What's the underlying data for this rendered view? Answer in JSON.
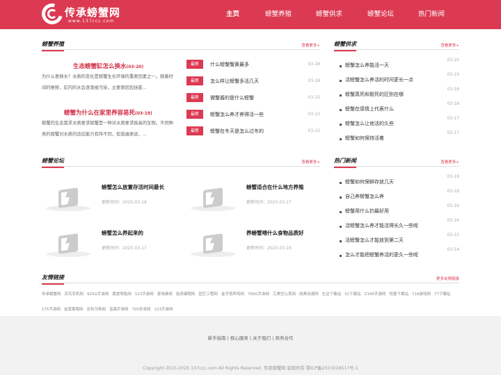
{
  "site": {
    "title": "传承螃蟹网",
    "domain": "www.137ccc.com"
  },
  "nav": [
    "主页",
    "螃蟹养殖",
    "螃蟹供求",
    "螃蟹论坛",
    "热门新闻"
  ],
  "yangzhi": {
    "title": "螃蟹养殖",
    "more": "查看更多+",
    "articles": [
      {
        "title": "生态螃蟹缸怎么换水",
        "date": "(03-20)",
        "desc": "为什么要换水？水质的变化是螃蟹生长环境的重要因素之一。随着时间的推移，缸内的水会逐渐被污染，主要原因包括废..."
      },
      {
        "title": "螃蟹为什么在家里养容易死",
        "date": "(03-19)",
        "desc": "螃蟹的生态需求水质要求螃蟹是一种对水质要求极高的生物。不同种类的螃蟹对水质的适应能力有所不同，但普遍来说，..."
      }
    ],
    "news": [
      {
        "badge": "最新",
        "text": "什么螃蟹蟹黄最多",
        "date": "03-18"
      },
      {
        "badge": "最新",
        "text": "怎么样让螃蟹多活几天",
        "date": "03-18"
      },
      {
        "badge": "最新",
        "text": "微蟹酱的是什么螃蟹",
        "date": "03-15"
      },
      {
        "badge": "最新",
        "text": "螃蟹怎么养才养得活一些",
        "date": "03-13"
      },
      {
        "badge": "最新",
        "text": "螃蟹在冬天是怎么过冬的",
        "date": "03-12"
      }
    ]
  },
  "gongqiu": {
    "title": "螃蟹供求",
    "more": "查看更多+",
    "items": [
      {
        "text": "螃蟹怎么养能活一天",
        "date": "03-20"
      },
      {
        "text": "活螃蟹怎么养活的时间更长一点",
        "date": "03-19"
      },
      {
        "text": "螃蟹真死和假死的区别在哪",
        "date": "03-18"
      },
      {
        "text": "螃蟹在感情上代表什么",
        "date": "03-18"
      },
      {
        "text": "螃蟹怎么让他活的久些",
        "date": "03-17"
      },
      {
        "text": "螃蟹如何保持活着",
        "date": "03-17"
      }
    ]
  },
  "luntan": {
    "title": "螃蟹论坛",
    "more": "查看更多+",
    "items": [
      {
        "title": "螃蟹怎么放置存活时间最长",
        "date": "更新时间：2025-03-18"
      },
      {
        "title": "螃蟹适合在什么地方养殖",
        "date": "更新时间：2025-03-17"
      },
      {
        "title": "螃蟹怎么养起来的",
        "date": "更新时间：2025-03-17"
      },
      {
        "title": "养螃蟹喂什么食物品质好",
        "date": "更新时间：2025-03-16"
      }
    ]
  },
  "hot": {
    "title": "热门新闻",
    "more": "查看更多+",
    "items": [
      {
        "text": "螃蟹如何保鲜存放几天",
        "date": "03-19"
      },
      {
        "text": "自己养螃蟹怎么养",
        "date": "03-18"
      },
      {
        "text": "螃蟹用什么钓最好用",
        "date": "03-16"
      },
      {
        "text": "活螃蟹怎么养才能活得长久一些呢",
        "date": "03-16"
      },
      {
        "text": "活螃蟹怎么才能放到第二天",
        "date": "03-15"
      },
      {
        "text": "怎么才能把螃蟹养活的更久一些呢",
        "date": "03-14"
      }
    ]
  },
  "links": {
    "title": "友情链接",
    "more": "更多友情链接",
    "items": [
      "传承螃蟹网",
      "百花农机网",
      "925G手游网",
      "黄霆零售网",
      "123手游网",
      "家电维修",
      "投资编程网",
      "园艺工程网",
      "金字塔养鸡网",
      "700G手游网",
      "艾美空心菜网",
      "晓美动漫网",
      "左边下载站",
      "52下载站",
      "Z166手游网",
      "悦夏下载站",
      "716游戏网",
      "77下载站",
      "175手游网",
      "金莫葡萄网",
      "宏利乌龟网",
      "显森手游网",
      "700安卓网",
      "223手游网"
    ]
  },
  "footer": {
    "links": "新手指南 | 核心服务 | 关于我们 | 商务合作",
    "copyright": "Copyright 2015-2025 137ccc.com All Rights Reserved. 传承螃蟹网 版权所有 鄂ICP备2023018517号-1"
  }
}
